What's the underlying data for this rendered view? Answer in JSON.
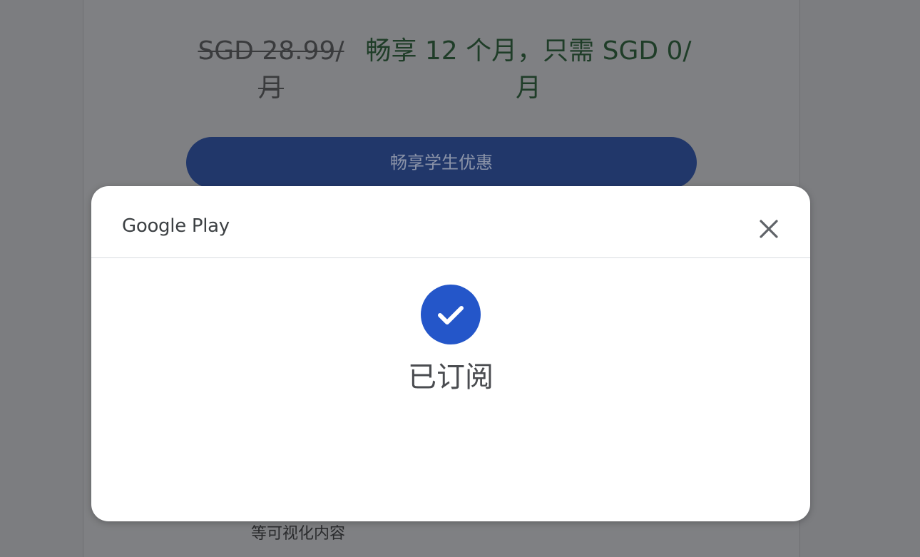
{
  "background": {
    "price_old_line1": "SGD 28.99/",
    "price_old_line2": "月",
    "price_new_line1": "畅享 12 个月，只需 SGD 0/",
    "price_new_line2": "月",
    "cta_label": "畅享学生优惠",
    "bottom_text": "等可视化内容"
  },
  "dialog": {
    "brand": "Google Play",
    "close_icon": "close-icon",
    "status_icon": "check-icon",
    "status_text": "已订阅"
  },
  "colors": {
    "overlay": "#7c7d80",
    "accent": "#2456c9",
    "cta_background": "#21376a",
    "price_new_text": "#1f3d28"
  }
}
